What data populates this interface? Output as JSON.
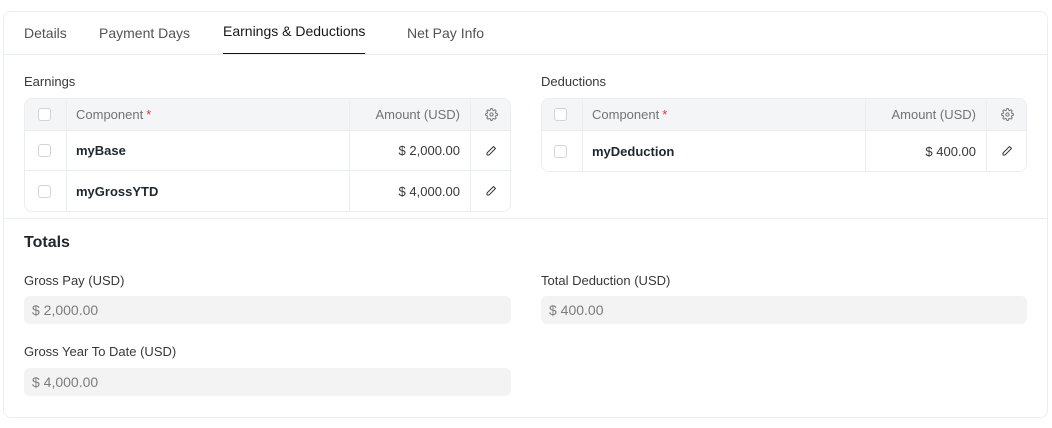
{
  "tabs": [
    {
      "label": "Details"
    },
    {
      "label": "Payment Days"
    },
    {
      "label": "Earnings & Deductions",
      "active": true
    },
    {
      "label": "Net Pay Info"
    }
  ],
  "earnings": {
    "title": "Earnings",
    "header": {
      "component": "Component",
      "required_mark": "*",
      "amount": "Amount (USD)"
    },
    "rows": [
      {
        "component": "myBase",
        "amount": "$ 2,000.00"
      },
      {
        "component": "myGrossYTD",
        "amount": "$ 4,000.00"
      }
    ]
  },
  "deductions": {
    "title": "Deductions",
    "header": {
      "component": "Component",
      "required_mark": "*",
      "amount": "Amount (USD)"
    },
    "rows": [
      {
        "component": "myDeduction",
        "amount": "$ 400.00"
      }
    ]
  },
  "totals": {
    "title": "Totals",
    "gross_pay": {
      "label": "Gross Pay (USD)",
      "value": "$ 2,000.00"
    },
    "total_deduction": {
      "label": "Total Deduction (USD)",
      "value": "$ 400.00"
    },
    "gross_ytd": {
      "label": "Gross Year To Date (USD)",
      "value": "$ 4,000.00"
    }
  },
  "icons": {
    "settings": "gear-icon",
    "edit": "pencil-icon"
  }
}
